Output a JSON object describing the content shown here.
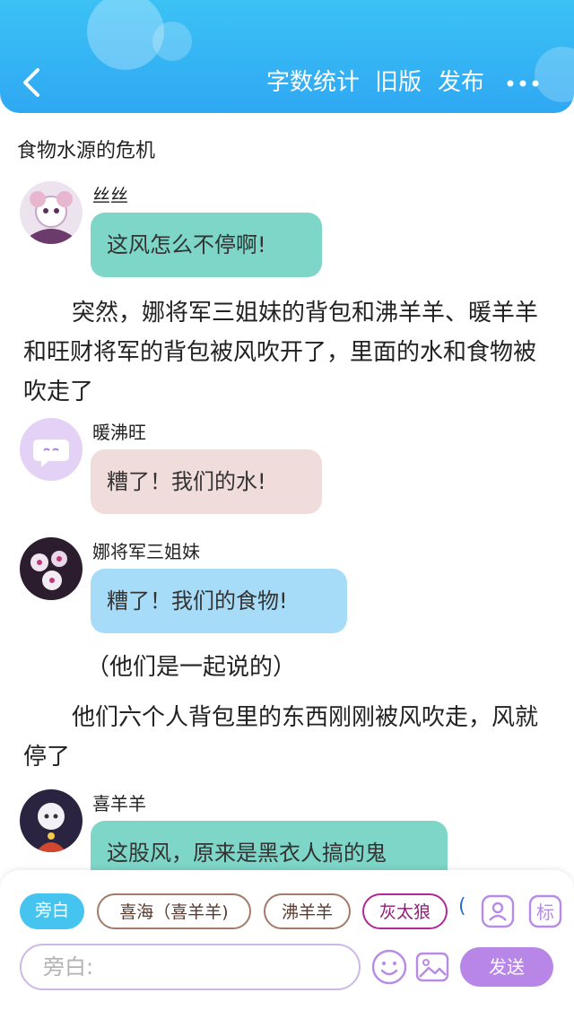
{
  "header": {
    "actions": {
      "stats": "字数统计",
      "old_version": "旧版",
      "publish": "发布"
    },
    "back_icon": "chevron-left-icon",
    "more_icon": "more-horizontal-icon",
    "colors": {
      "top": "#3cc2f5",
      "bottom": "#2fa8f3"
    }
  },
  "story": {
    "title": "食物水源的危机",
    "blocks": {
      "m1": {
        "speaker": "丝丝",
        "text": "这风怎么不停啊!",
        "bubble_color": "#7dd6c7"
      },
      "n1": {
        "text": "突然，娜将军三姐妹的背包和沸羊羊、暖羊羊和旺财将军的背包被风吹开了，里面的水和食物被吹走了"
      },
      "m2": {
        "speaker": "暖沸旺",
        "text": "糟了！我们的水!",
        "bubble_color": "#f1dcdc"
      },
      "m3": {
        "speaker": "娜将军三姐妹",
        "text": "糟了！我们的食物!",
        "bubble_color": "#a6dcf7"
      },
      "n2": {
        "text": "（他们是一起说的）"
      },
      "n3": {
        "text": "他们六个人背包里的东西刚刚被风吹走，风就停了"
      },
      "m4": {
        "speaker": "喜羊羊",
        "text": "这股风，原来是黑衣人搞的鬼",
        "bubble_color": "#7dd6c7"
      }
    }
  },
  "composer": {
    "roles": {
      "narrator": "旁白",
      "r1": "喜海（喜羊羊)",
      "r2": "沸羊羊",
      "r3": "灰太狼",
      "partial": "("
    },
    "role_icon": "person-card-icon",
    "tag_icon_text": "标",
    "input_placeholder": "旁白:",
    "emoji_icon": "smile-icon",
    "image_icon": "image-icon",
    "send_label": "发送",
    "accent": "#b786e6"
  }
}
